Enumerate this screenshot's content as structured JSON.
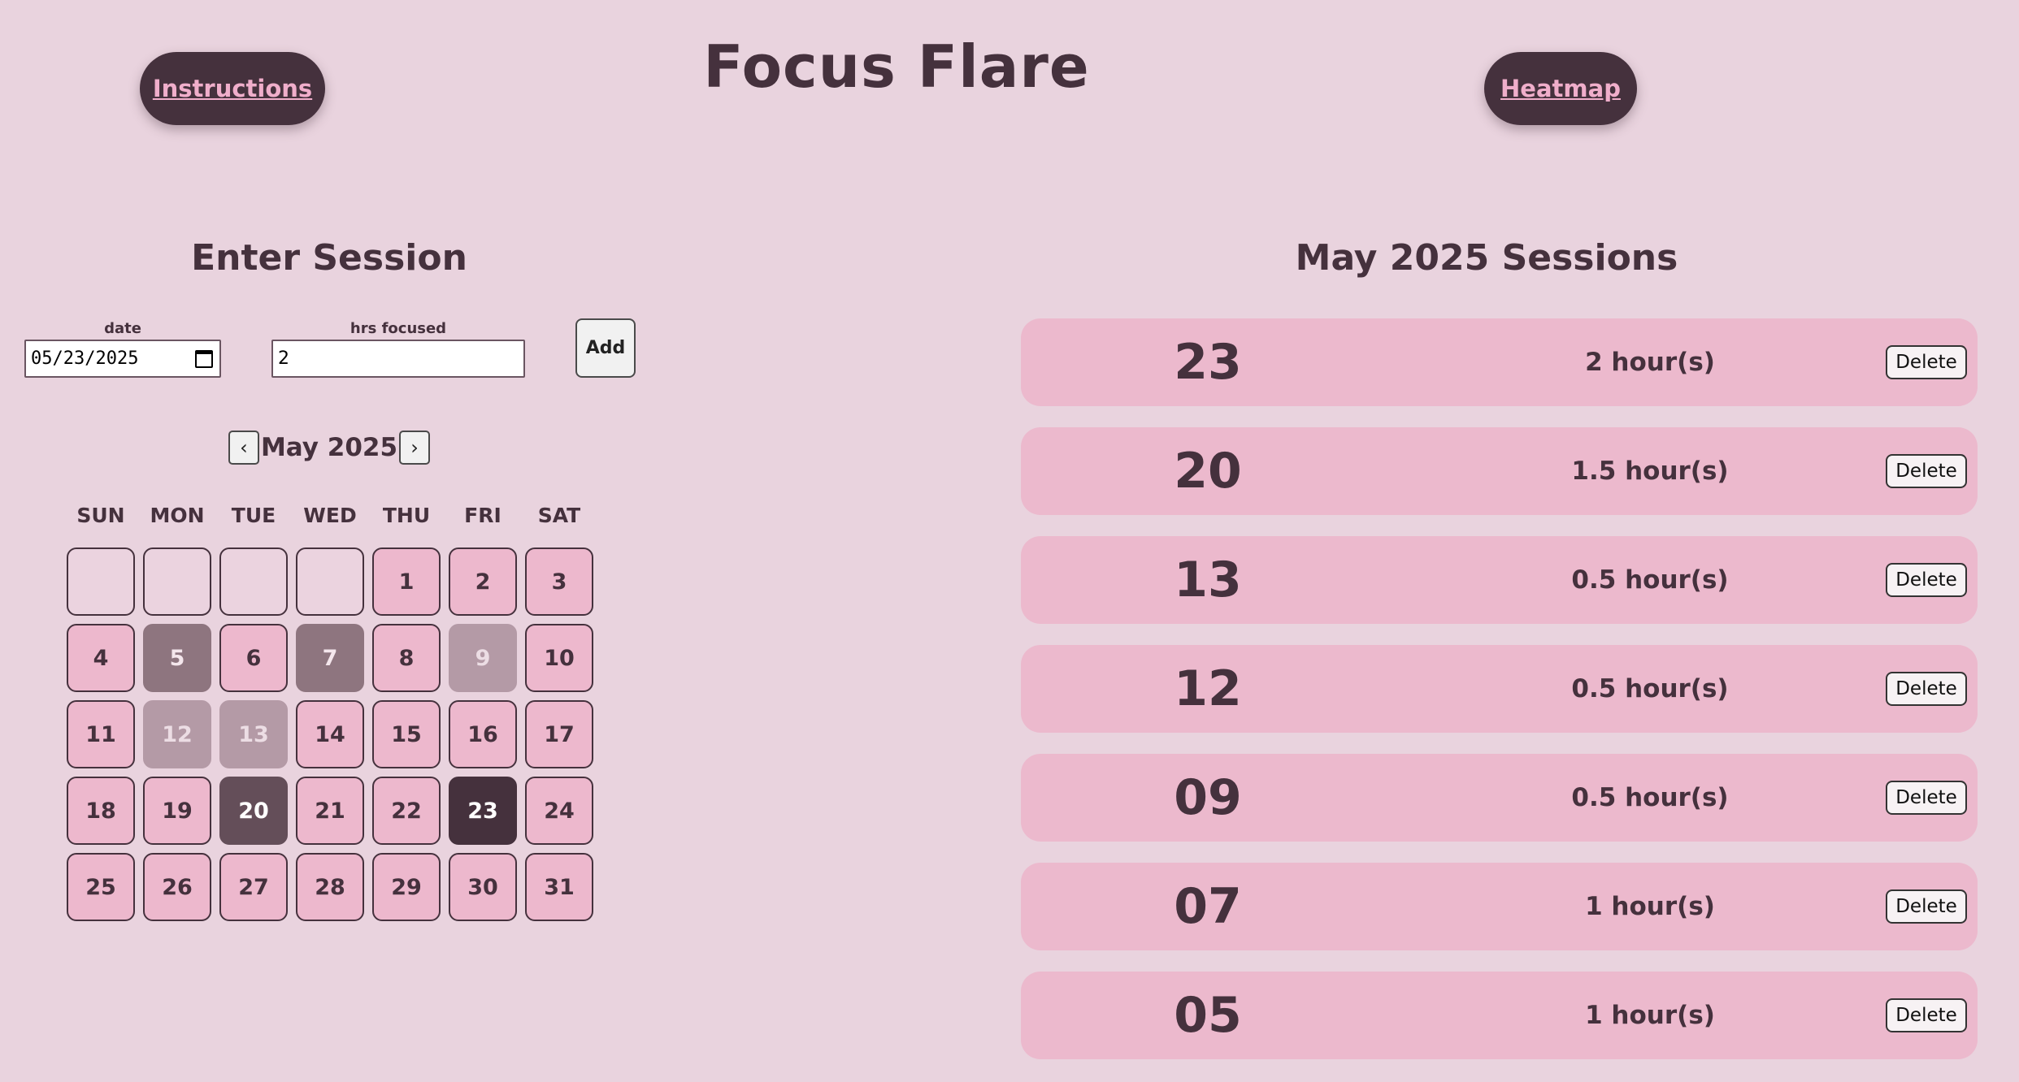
{
  "header": {
    "title": "Focus Flare",
    "instructions_label": "Instructions",
    "heatmap_label": "Heatmap"
  },
  "entry": {
    "title": "Enter Session",
    "date_label": "date",
    "date_value": "05/23/2025",
    "hours_label": "hrs focused",
    "hours_value": "2",
    "add_label": "Add"
  },
  "calendar": {
    "month_label": "May 2025",
    "prev_icon": "chevron-left-icon",
    "next_icon": "chevron-right-icon",
    "prev_glyph": "‹",
    "next_glyph": "›",
    "weekdays": [
      "SUN",
      "MON",
      "TUE",
      "WED",
      "THU",
      "FRI",
      "SAT"
    ],
    "leading_blanks": 4,
    "days": [
      {
        "d": "1",
        "level": 0
      },
      {
        "d": "2",
        "level": 0
      },
      {
        "d": "3",
        "level": 0
      },
      {
        "d": "4",
        "level": 0
      },
      {
        "d": "5",
        "level": 2
      },
      {
        "d": "6",
        "level": 0
      },
      {
        "d": "7",
        "level": 2
      },
      {
        "d": "8",
        "level": 0
      },
      {
        "d": "9",
        "level": 1
      },
      {
        "d": "10",
        "level": 0
      },
      {
        "d": "11",
        "level": 0
      },
      {
        "d": "12",
        "level": 1
      },
      {
        "d": "13",
        "level": 1
      },
      {
        "d": "14",
        "level": 0
      },
      {
        "d": "15",
        "level": 0
      },
      {
        "d": "16",
        "level": 0
      },
      {
        "d": "17",
        "level": 0
      },
      {
        "d": "18",
        "level": 0
      },
      {
        "d": "19",
        "level": 0
      },
      {
        "d": "20",
        "level": 3
      },
      {
        "d": "21",
        "level": 0
      },
      {
        "d": "22",
        "level": 0
      },
      {
        "d": "23",
        "level": 4
      },
      {
        "d": "24",
        "level": 0
      },
      {
        "d": "25",
        "level": 0
      },
      {
        "d": "26",
        "level": 0
      },
      {
        "d": "27",
        "level": 0
      },
      {
        "d": "28",
        "level": 0
      },
      {
        "d": "29",
        "level": 0
      },
      {
        "d": "30",
        "level": 0
      },
      {
        "d": "31",
        "level": 0
      }
    ]
  },
  "sessions": {
    "title": "May 2025 Sessions",
    "delete_label": "Delete",
    "items": [
      {
        "day": "23",
        "hours": "2 hour(s)"
      },
      {
        "day": "20",
        "hours": "1.5 hour(s)"
      },
      {
        "day": "13",
        "hours": "0.5 hour(s)"
      },
      {
        "day": "12",
        "hours": "0.5 hour(s)"
      },
      {
        "day": "09",
        "hours": "0.5 hour(s)"
      },
      {
        "day": "07",
        "hours": "1 hour(s)"
      },
      {
        "day": "05",
        "hours": "1 hour(s)"
      }
    ]
  },
  "colors": {
    "background": "#e9d3de",
    "dark": "#45313d",
    "pink": "#ecb9cd",
    "accent_text": "#f0aecb"
  }
}
